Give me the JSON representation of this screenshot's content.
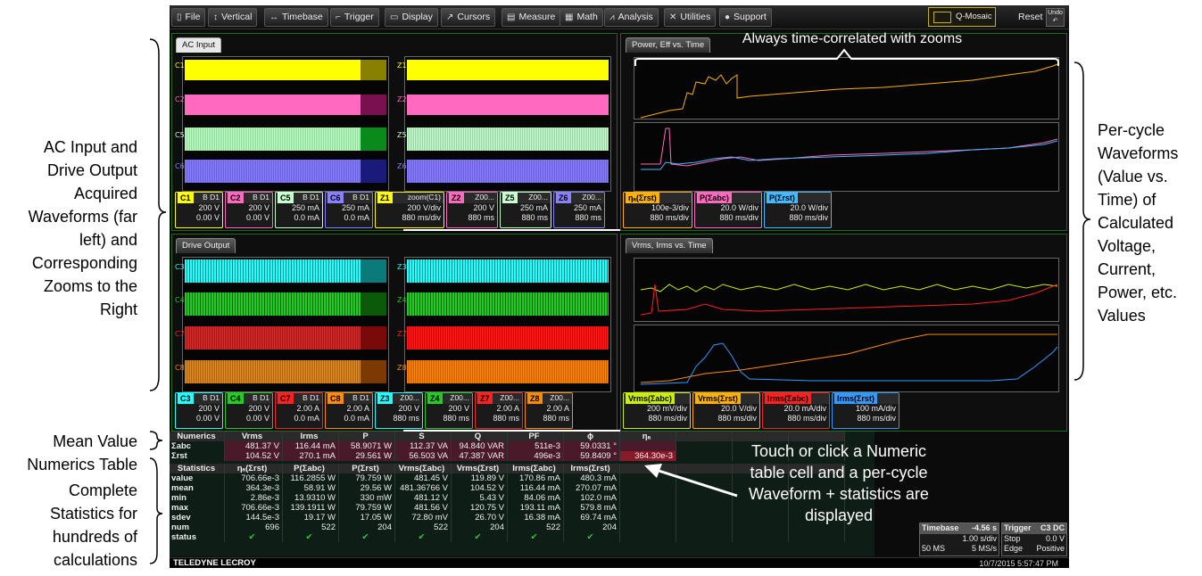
{
  "annotations": {
    "left_top": "AC Input and Drive Output Acquired Waveforms (far left) and Corresponding Zooms to the Right",
    "left_mid": "Mean Value Numerics Table",
    "left_bot": "Complete Statistics for hundreds of calculations",
    "right": "Per-cycle Waveforms (Value vs. Time) of Calculated Voltage, Current, Power, etc. Values",
    "top": "Always time-correlated with zooms",
    "callout": "Touch or click a Numeric table cell and a per-cycle Waveform + statistics are displayed"
  },
  "menu": [
    {
      "label": "File",
      "icon": "file-icon",
      "glyph": "▯"
    },
    {
      "label": "Vertical",
      "icon": "vertical-icon",
      "glyph": "↕"
    },
    {
      "label": "Timebase",
      "icon": "timebase-icon",
      "glyph": "↔"
    },
    {
      "label": "Trigger",
      "icon": "trigger-icon",
      "glyph": "⌐"
    },
    {
      "label": "Display",
      "icon": "display-icon",
      "glyph": "▭"
    },
    {
      "label": "Cursors",
      "icon": "cursors-icon",
      "glyph": "↗"
    },
    {
      "label": "Measure",
      "icon": "measure-icon",
      "glyph": "▤"
    },
    {
      "label": "Math",
      "icon": "math-icon",
      "glyph": "▦"
    },
    {
      "label": "Analysis",
      "icon": "analysis-icon",
      "glyph": "⩘"
    },
    {
      "label": "Utilities",
      "icon": "utilities-icon",
      "glyph": "✕"
    },
    {
      "label": "Support",
      "icon": "support-icon",
      "glyph": "●"
    }
  ],
  "qmosaic": "Q-Mosaic",
  "reset": "Reset",
  "undo": "Undo",
  "tabs": {
    "ac_input": "AC Input",
    "power": "Power, Eff vs. Time",
    "drive": "Drive Output",
    "vrms": "Vrms, Irms vs. Time"
  },
  "colors": {
    "c1": "#ffff00",
    "c2": "#ff69c0",
    "c5": "#c8ffd0",
    "c6": "#8a80ff",
    "c3": "#22ffff",
    "c4": "#22cc22",
    "c7": "#ff2020",
    "c8": "#ff8c00"
  },
  "ac_desc": [
    {
      "tag": "C1",
      "sub": "B D1",
      "v1": "200 V",
      "v2": "0.00 V",
      "color": "#ffff00"
    },
    {
      "tag": "C2",
      "sub": "B D1",
      "v1": "200 V",
      "v2": "0.00 V",
      "color": "#ff69c0"
    },
    {
      "tag": "C5",
      "sub": "B D1",
      "v1": "250 mA",
      "v2": "0.0 mA",
      "color": "#c8ffd0"
    },
    {
      "tag": "C6",
      "sub": "B D1",
      "v1": "250 mA",
      "v2": "0.0 mA",
      "color": "#8a80ff"
    },
    {
      "tag": "Z1",
      "sub": "zoom(C1)",
      "v1": "200 V/div",
      "v2": "880 ms/div",
      "color": "#ffff00"
    },
    {
      "tag": "Z2",
      "sub": "Z00...",
      "v1": "200 V",
      "v2": "880 ms",
      "color": "#ff69c0"
    },
    {
      "tag": "Z5",
      "sub": "Z00...",
      "v1": "250 mA",
      "v2": "880 ms",
      "color": "#c8ffd0"
    },
    {
      "tag": "Z6",
      "sub": "Z00...",
      "v1": "250 mA",
      "v2": "880 ms",
      "color": "#8a80ff"
    }
  ],
  "drive_desc": [
    {
      "tag": "C3",
      "sub": "B D1",
      "v1": "200 V",
      "v2": "0.00 V",
      "color": "#22ffff"
    },
    {
      "tag": "C4",
      "sub": "B D1",
      "v1": "200 V",
      "v2": "0.00 V",
      "color": "#22cc22"
    },
    {
      "tag": "C7",
      "sub": "B D1",
      "v1": "2.00 A",
      "v2": "0.0 mA",
      "color": "#ff2020"
    },
    {
      "tag": "C8",
      "sub": "B D1",
      "v1": "2.00 A",
      "v2": "0.0 mA",
      "color": "#ff8c00"
    },
    {
      "tag": "Z3",
      "sub": "Z00...",
      "v1": "200 V",
      "v2": "880 ms",
      "color": "#22ffff"
    },
    {
      "tag": "Z4",
      "sub": "Z00...",
      "v1": "200 V",
      "v2": "880 ms",
      "color": "#22cc22"
    },
    {
      "tag": "Z7",
      "sub": "Z00...",
      "v1": "2.00 A",
      "v2": "880 ms",
      "color": "#ff2020"
    },
    {
      "tag": "Z8",
      "sub": "Z00...",
      "v1": "2.00 A",
      "v2": "880 ms",
      "color": "#ff8c00"
    }
  ],
  "power_desc": [
    {
      "tag": "ηₐ(Σrst)",
      "v1": "100e-3/div",
      "v2": "880 ms/div",
      "color": "#ffb000"
    },
    {
      "tag": "P(Σabc)",
      "v1": "20.0 W/div",
      "v2": "880 ms/div",
      "color": "#ff69c0"
    },
    {
      "tag": "P(Σrst)",
      "v1": "20.0 W/div",
      "v2": "880 ms/div",
      "color": "#44bbff"
    }
  ],
  "vrms_desc": [
    {
      "tag": "Vrms(Σabc)",
      "v1": "200 mV/div",
      "v2": "880 ms/div",
      "color": "#ccee00"
    },
    {
      "tag": "Vrms(Σrst)",
      "v1": "20.0 V/div",
      "v2": "880 ms/div",
      "color": "#ffb000"
    },
    {
      "tag": "Irms(Σabc)",
      "v1": "20.0 mA/div",
      "v2": "880 ms/div",
      "color": "#ff2020"
    },
    {
      "tag": "Irms(Σrst)",
      "v1": "100 mA/div",
      "v2": "880 ms/div",
      "color": "#3399ff"
    }
  ],
  "numerics": {
    "header": [
      "Numerics",
      "Vrms",
      "Irms",
      "P",
      "S",
      "Q",
      "PF",
      "ϕ",
      "ηₐ"
    ],
    "rows": [
      [
        "Σabc",
        "481.37 V",
        "116.44 mA",
        "58.9071 W",
        "112.37 VA",
        "94.840 VAR",
        "511e-3",
        "59.0331 °",
        ""
      ],
      [
        "Σrst",
        "104.52 V",
        "270.1 mA",
        "29.561 W",
        "56.503 VA",
        "47.387 VAR",
        "496e-3",
        "59.8409 °",
        "364.30e-3"
      ]
    ]
  },
  "statistics": {
    "header": [
      "Statistics",
      "ηₐ(Σrst)",
      "P(Σabc)",
      "P(Σrst)",
      "Vrms(Σabc)",
      "Vrms(Σrst)",
      "Irms(Σabc)",
      "Irms(Σrst)"
    ],
    "rows": [
      [
        "value",
        "706.66e-3",
        "116.2855 W",
        "79.759 W",
        "481.45 V",
        "119.89 V",
        "170.86 mA",
        "480.3 mA"
      ],
      [
        "mean",
        "364.3e-3",
        "58.91 W",
        "29.56 W",
        "481.36766 V",
        "104.52 V",
        "116.44 mA",
        "270.07 mA"
      ],
      [
        "min",
        "2.86e-3",
        "13.9310 W",
        "330 mW",
        "481.12 V",
        "5.43 V",
        "84.06 mA",
        "102.0 mA"
      ],
      [
        "max",
        "706.66e-3",
        "139.1911 W",
        "79.759 W",
        "481.56 V",
        "120.75 V",
        "193.11 mA",
        "579.8 mA"
      ],
      [
        "sdev",
        "144.5e-3",
        "19.17 W",
        "17.05 W",
        "72.80 mV",
        "26.70 V",
        "16.38 mA",
        "69.74 mA"
      ],
      [
        "num",
        "696",
        "522",
        "204",
        "522",
        "204",
        "522",
        "204"
      ],
      [
        "status",
        "✔",
        "✔",
        "✔",
        "✔",
        "✔",
        "✔",
        "✔"
      ]
    ]
  },
  "timebase": {
    "title": "Timebase",
    "offset": "-4.56 s",
    "div": "1.00 s/div",
    "rate": "5 MS/s",
    "samples": "50 MS"
  },
  "trigger": {
    "title": "Trigger",
    "ch": "C3",
    "coupling": "DC",
    "mode": "Stop",
    "level": "0.0 V",
    "type": "Edge",
    "slope": "Positive"
  },
  "brand": "TELEDYNE LECROY",
  "datetime": "10/7/2015 5:57:47 PM"
}
